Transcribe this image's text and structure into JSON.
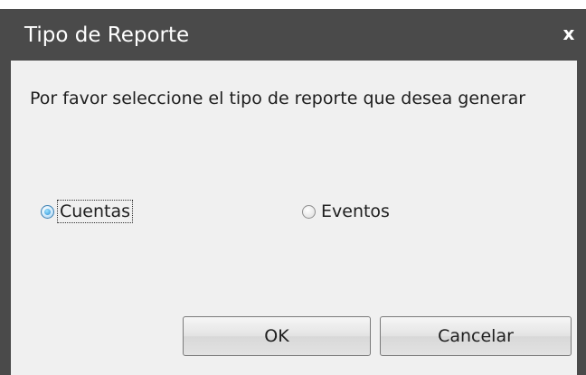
{
  "dialog": {
    "title": "Tipo de Reporte",
    "close_label": "x",
    "message": "Por favor seleccione el tipo de reporte que desea generar",
    "options": [
      {
        "label": "Cuentas",
        "checked": true
      },
      {
        "label": "Eventos",
        "checked": false
      }
    ],
    "ok_label": "OK",
    "cancel_label": "Cancelar"
  }
}
